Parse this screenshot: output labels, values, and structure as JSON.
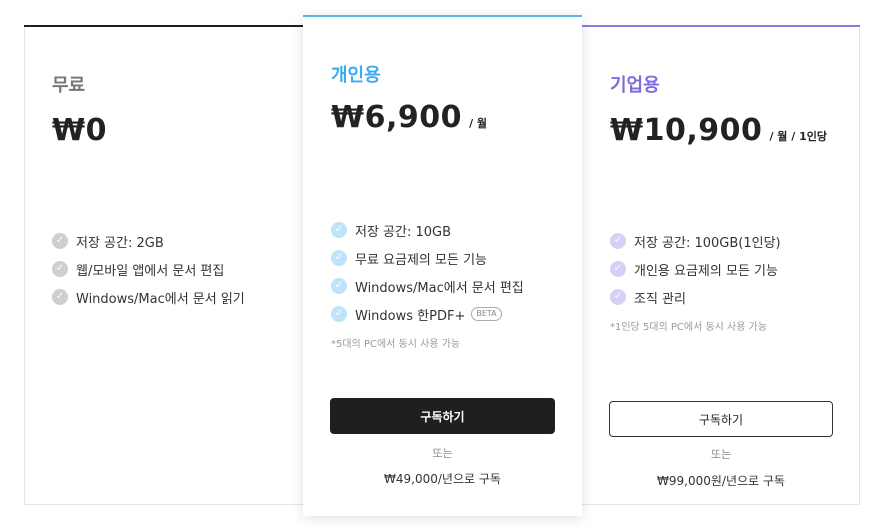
{
  "plans": {
    "free": {
      "name": "무료",
      "price": "₩0",
      "features": [
        "저장 공간: 2GB",
        "웹/모바일 앱에서 문서 편집",
        "Windows/Mac에서 문서 읽기"
      ]
    },
    "personal": {
      "name": "개인용",
      "price": "₩6,900",
      "period": "/ 월",
      "features": [
        "저장 공간: 10GB",
        "무료 요금제의 모든 기능",
        "Windows/Mac에서 문서 편집",
        "Windows 한PDF+"
      ],
      "beta_badge": "BETA",
      "footnote": "*5대의 PC에서 동시 사용 가능",
      "subscribe_label": "구독하기",
      "or_label": "또는",
      "annual_label": "₩49,000/년으로 구독"
    },
    "enterprise": {
      "name": "기업용",
      "price": "₩10,900",
      "period": "/ 월 / 1인당",
      "features": [
        "저장 공간: 100GB(1인당)",
        "개인용 요금제의 모든 기능",
        "조직 관리"
      ],
      "footnote": "*1인당 5대의 PC에서 동시 사용 가능",
      "subscribe_label": "구독하기",
      "or_label": "또는",
      "annual_label": "₩99,000원/년으로 구독"
    }
  },
  "icons": {
    "feature_check": "check-circle-icon"
  },
  "colors": {
    "free_accent": "#1f1f1f",
    "personal_accent": "#3fa9ee",
    "enterprise_accent": "#7b6ce0",
    "primary_button": "#1f1f1f"
  }
}
